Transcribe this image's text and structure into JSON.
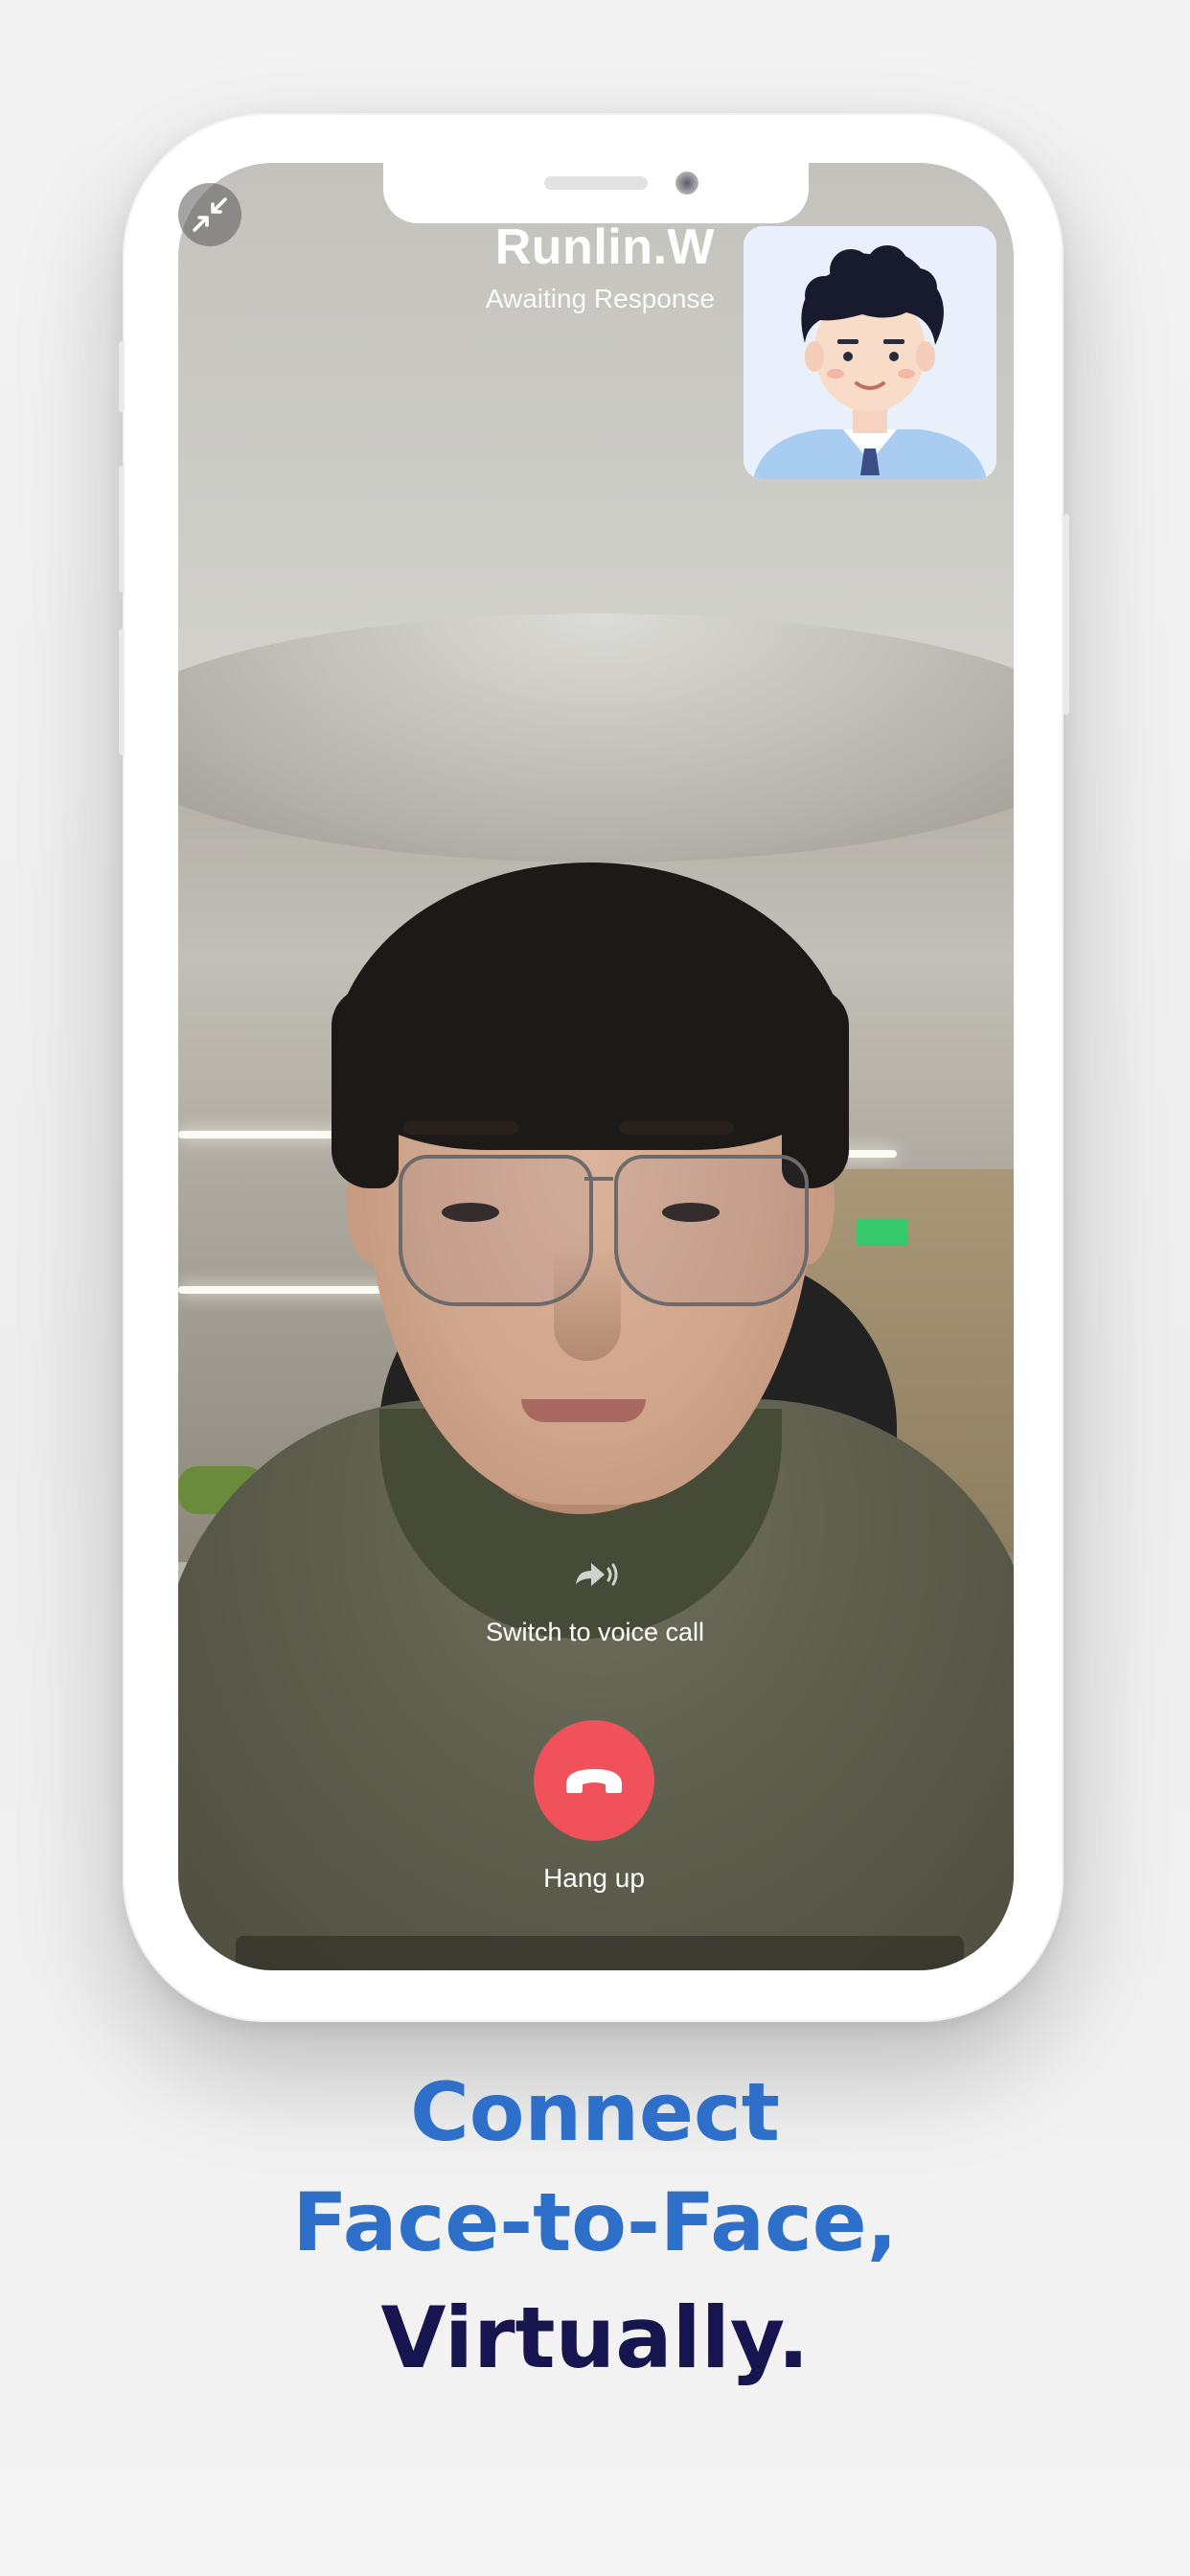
{
  "call": {
    "caller_name": "Runlin.W",
    "status": "Awaiting Response",
    "switch_label": "Switch to voice call",
    "hangup_label": "Hang up"
  },
  "icons": {
    "collapse": "collapse-arrows-icon",
    "voice": "voice-call-icon",
    "hangup": "phone-hangup-icon"
  },
  "colors": {
    "hangup": "#f0515a",
    "headline_blue": "#2d6fc9",
    "headline_navy": "#17154f"
  },
  "headline": {
    "line1": "Connect",
    "line2": "Face-to-Face,",
    "line3": "Virtually."
  }
}
